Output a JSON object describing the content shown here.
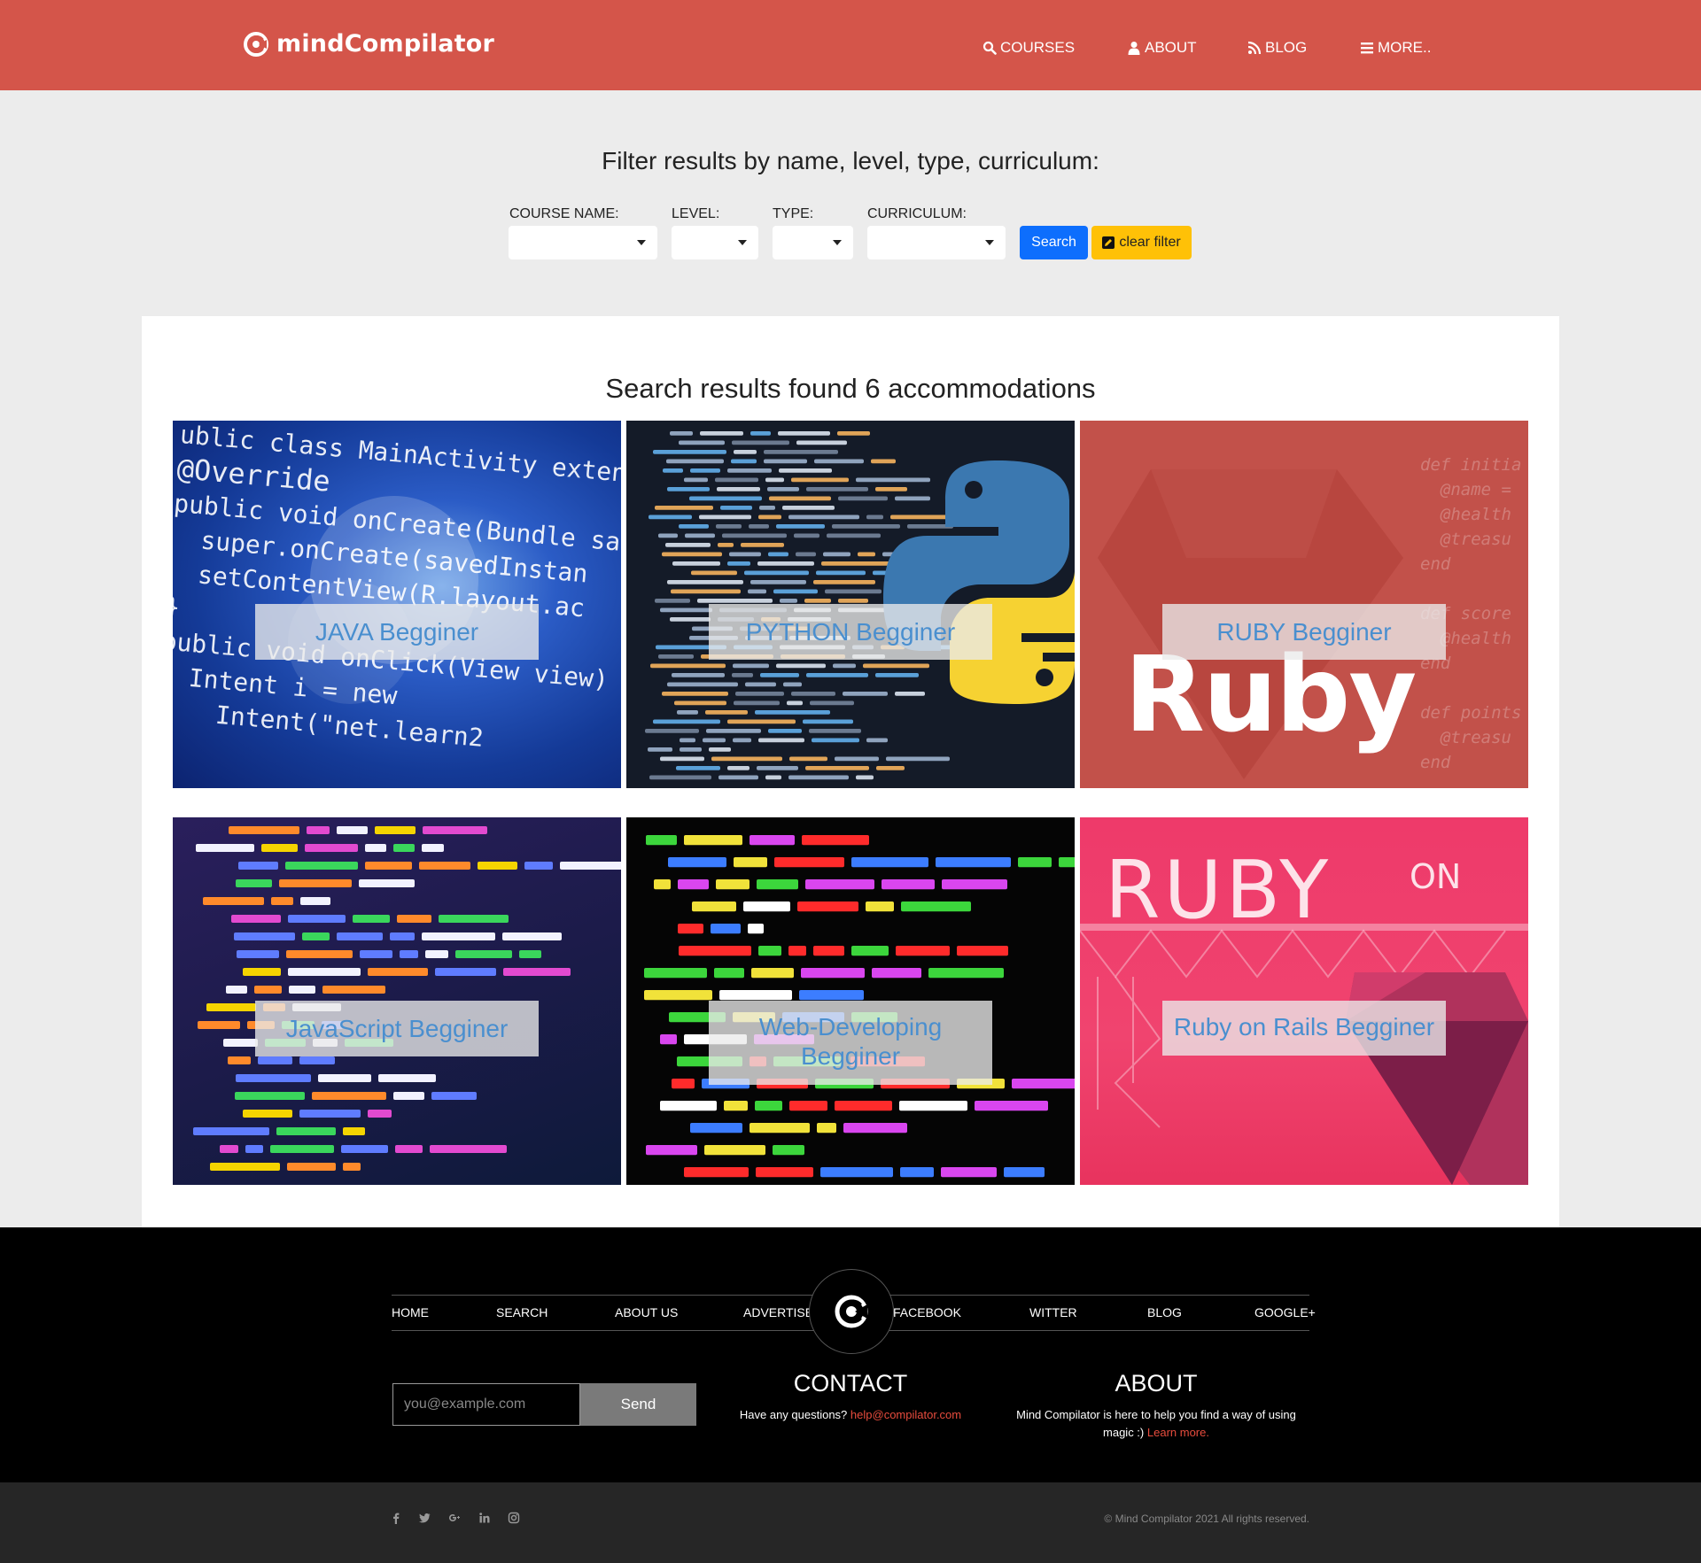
{
  "brand": {
    "name": "mindCompilator"
  },
  "nav": {
    "courses": "COURSES",
    "about": "ABOUT",
    "blog": "BLOG",
    "more": "MORE.."
  },
  "filter": {
    "title": "Filter results by name, level, type, curriculum:",
    "course_name_label": "COURSE NAME:",
    "level_label": "LEVEL:",
    "type_label": "TYPE:",
    "curriculum_label": "CURRICULUM:",
    "search_label": "Search",
    "clear_label": "clear filter"
  },
  "results": {
    "title": "Search results found 6 accommodations",
    "cards": [
      {
        "label": "JAVA Begginer"
      },
      {
        "label": "PYTHON Begginer"
      },
      {
        "label": "RUBY Begginer"
      },
      {
        "label": "JavaScript Begginer"
      },
      {
        "label": "Web-Developing Begginer"
      },
      {
        "label": "Ruby on Rails Begginer"
      }
    ],
    "card_art": {
      "java": [
        "ublic class MainActivity extends",
        "@Override",
        "public void onCreate(Bundle sa",
        "  super.onCreate(savedInstan",
        "  setContentView(R.layout.ac",
        "}",
        "public void onClick(View view)",
        "  Intent i = new",
        "    Intent(\"net.learn2"
      ],
      "ruby_code": [
        "def initia",
        "  @name =",
        "  @health",
        "  @treasu",
        "end",
        "",
        "def score",
        "  @health",
        "end",
        "",
        "def points",
        "  @treasu",
        "end"
      ],
      "ruby_word": "Ruby",
      "rails_word": "RUBY",
      "rails_on": "ON"
    }
  },
  "footer": {
    "nav": [
      "HOME",
      "SEARCH",
      "ABOUT US",
      "ADVERTISE",
      "FACEBOOK",
      "WITTER",
      "BLOG",
      "GOOGLE+"
    ],
    "email_placeholder": "you@example.com",
    "send_label": "Send",
    "contact_heading": "CONTACT",
    "contact_text": "Have any questions?",
    "contact_email": "help@compilator.com",
    "about_heading": "ABOUT",
    "about_text": "Mind Compilator is here to help you find a way of using magic :)",
    "about_link": "Learn more.",
    "copyright": "© Mind Compilator 2021 All rights reserved.",
    "social_icons": [
      "facebook-icon",
      "twitter-icon",
      "google-plus-icon",
      "linkedin-icon",
      "instagram-icon"
    ]
  },
  "colors": {
    "navbar": "#d4554a",
    "search_button": "#0d6efd",
    "clear_button": "#ffc107",
    "card_label_text": "#4a8fcf",
    "link": "#e84c3d"
  }
}
